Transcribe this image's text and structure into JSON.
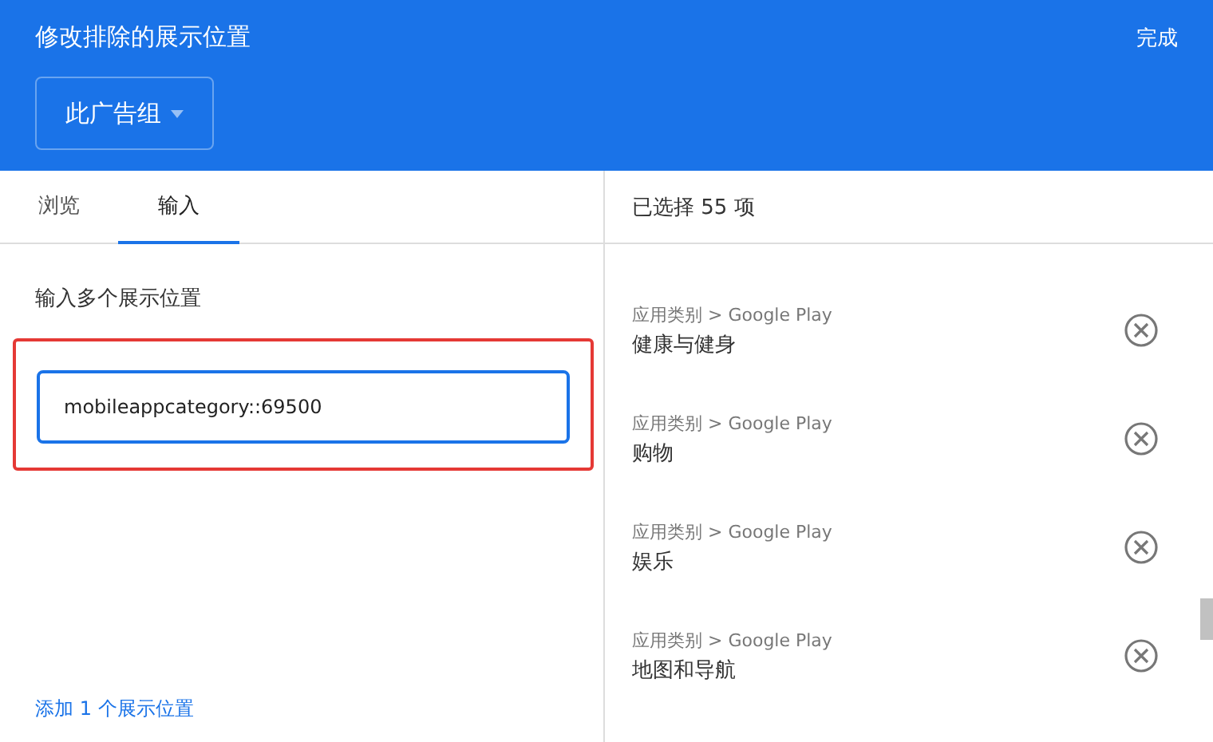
{
  "header": {
    "title": "修改排除的展示位置",
    "done_button": "完成",
    "scope_dropdown": "此广告组"
  },
  "tabs": [
    {
      "label": "浏览",
      "selected": false
    },
    {
      "label": "输入",
      "selected": true
    }
  ],
  "input_panel": {
    "label": "输入多个展示位置",
    "value": "mobileappcategory::69500",
    "highlighted": true,
    "add_link": "添加 1 个展示位置"
  },
  "selection": {
    "count": "已选择 55 项",
    "items": [
      {
        "category": "应用类别 > Google Play",
        "name": "健康与健身"
      },
      {
        "category": "应用类别 > Google Play",
        "name": "购物"
      },
      {
        "category": "应用类别 > Google Play",
        "name": "娱乐"
      },
      {
        "category": "应用类别 > Google Play",
        "name": "地图和导航"
      }
    ]
  }
}
